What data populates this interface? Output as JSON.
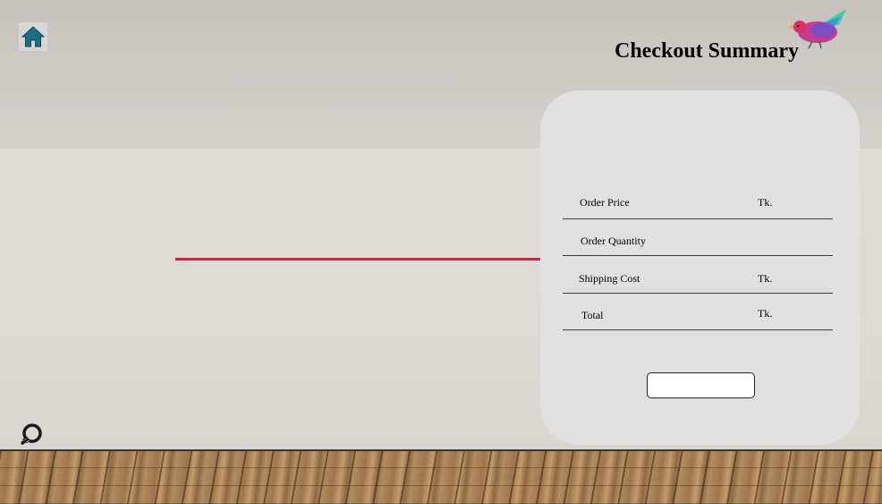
{
  "page": {
    "title": "Checkout Summary"
  },
  "icons": {
    "home": "home-icon",
    "refresh": "refresh-icon",
    "logo": "bird-logo-icon"
  },
  "colors": {
    "accent_line": "#c32a3f",
    "home_icon": "#1f6c85",
    "card_bg": "#e0e0e0"
  },
  "summary": {
    "rows": [
      {
        "label": "Order Price",
        "currency": "Tk."
      },
      {
        "label": "Order Quantity",
        "currency": ""
      },
      {
        "label": "Shipping Cost",
        "currency": "Tk."
      },
      {
        "label": "Total",
        "currency": "Tk."
      }
    ],
    "confirm_label": ""
  }
}
